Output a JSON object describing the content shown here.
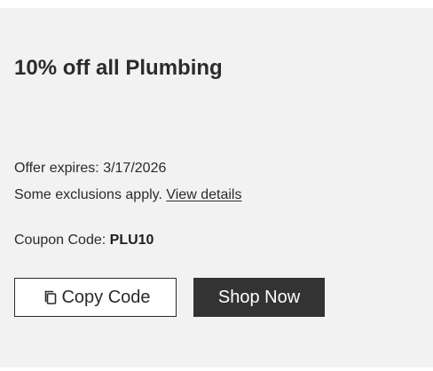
{
  "offer": {
    "title": "10% off all Plumbing",
    "expires_text": "Offer expires: 3/17/2026",
    "exclusions_text": "Some exclusions apply.",
    "details_link": "View details",
    "coupon_label": "Coupon Code:",
    "coupon_code": "PLU10"
  },
  "buttons": {
    "copy_label": "Copy Code",
    "copy_icon": "copy-icon",
    "shop_label": "Shop Now"
  }
}
